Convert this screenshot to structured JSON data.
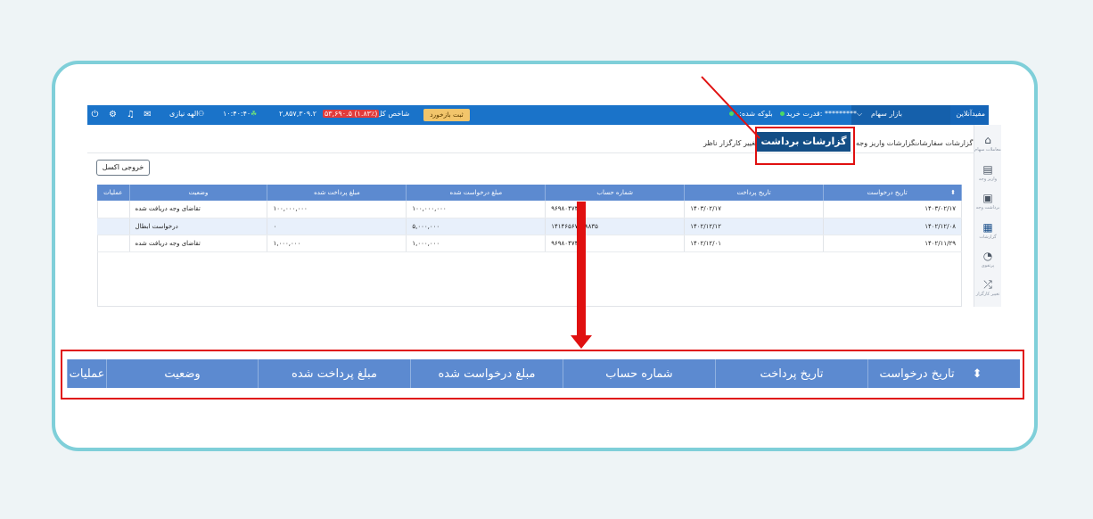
{
  "topbar": {
    "brand": "مفید‌آنلاین",
    "market": "بازار سهام",
    "buying_power_label": "قدرت خرید:",
    "buying_power_value": "*********",
    "blocked_label": "بلوکه شده:",
    "blocked_value": "۰",
    "index_label": "شاخص کل",
    "index_value": "۲,۸۵۷,۳۰۹.۲",
    "index_change": "۵۳,۶۹۰.۵ (۱.۸۳٪)",
    "feedback_button": "ثبت بازخورد",
    "clock": "۱۰:۴۰:۴۰",
    "user_name": "الهه نیازی",
    "icons": [
      "mail-icon",
      "bell-icon",
      "gear-icon",
      "power-icon"
    ]
  },
  "nav": {
    "items": [
      {
        "label": "معاملات سهام",
        "icon": "home-icon"
      },
      {
        "label": "واریز وجه",
        "icon": "deposit-icon"
      },
      {
        "label": "برداشت وجه",
        "icon": "wallet-icon"
      },
      {
        "label": "گزارشات",
        "icon": "report-icon"
      },
      {
        "label": "پرتفوی",
        "icon": "pie-icon"
      },
      {
        "label": "تغییر کارگزار",
        "icon": "shuffle-icon"
      }
    ]
  },
  "tabs": {
    "orders": "گزارشات سفارشات",
    "deposits": "گزارشات واریز وجه",
    "withdrawals": "گزارشات برداشت وجه",
    "broker_change": "تغییر کارگزار ناظر"
  },
  "export_button": "خروجی اکسل",
  "table": {
    "headers": [
      "تاریخ درخواست",
      "تاریخ پرداخت",
      "شماره حساب",
      "مبلغ درخواست شده",
      "مبلغ پرداخت شده",
      "وضعیت",
      "عملیات"
    ],
    "rows": [
      [
        "۱۴۰۳/۰۲/۱۷",
        "۱۴۰۳/۰۲/۱۷",
        "۹۶۹۸۰۴۷۴۵۰",
        "۱۰۰,۰۰۰,۰۰۰",
        "۱۰۰,۰۰۰,۰۰۰",
        "تقاضای وجه دریافت شده",
        ""
      ],
      [
        "۱۴۰۲/۱۲/۰۸",
        "۱۴۰۲/۱۲/۱۲",
        "۱۴۱۴۶۵۶۷۸۸۸۸۳۵",
        "۵,۰۰۰,۰۰۰",
        "۰",
        "درخواست ابطال",
        ""
      ],
      [
        "۱۴۰۲/۱۱/۲۹",
        "۱۴۰۲/۱۲/۰۱",
        "۹۶۹۸۰۴۷۴۵۰",
        "۱,۰۰۰,۰۰۰",
        "۱,۰۰۰,۰۰۰",
        "تقاضای وجه دریافت شده",
        ""
      ]
    ]
  },
  "zoom": {
    "headers": [
      "تاریخ درخواست",
      "تاریخ پرداخت",
      "شماره حساب",
      "مبلغ درخواست شده",
      "مبلغ پرداخت شده",
      "وضعیت",
      "عملیات"
    ]
  },
  "colors": {
    "topbar": "#1a73c9",
    "table_header": "#5c8ad0",
    "active_tab": "#134e86",
    "callout": "#e01010",
    "frame_border": "#7fcfd9"
  }
}
